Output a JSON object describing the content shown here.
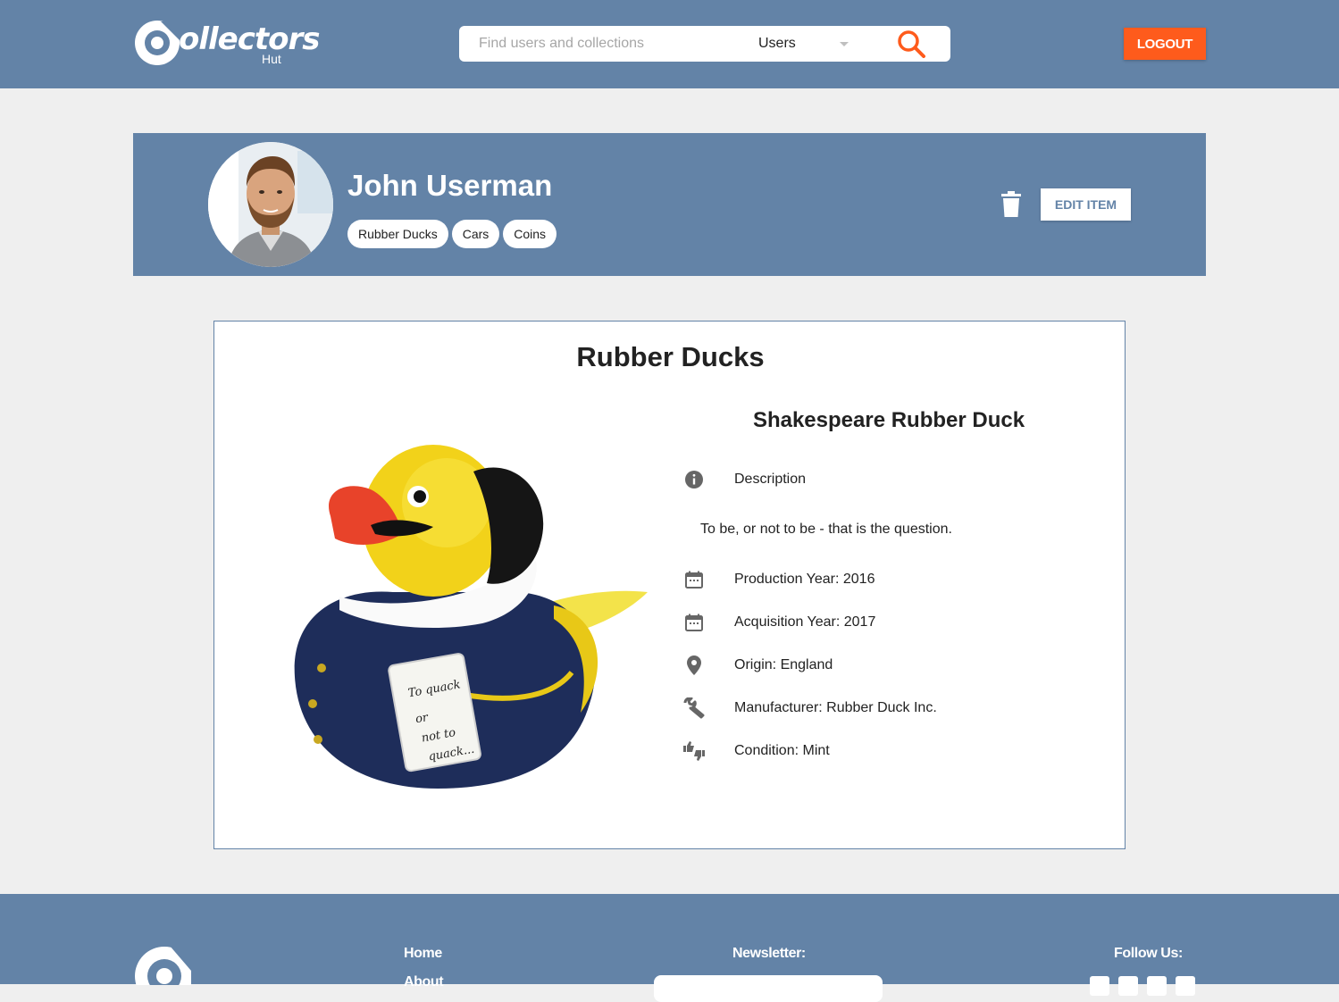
{
  "header": {
    "logo_word": "ollectors",
    "logo_sub": "Hut",
    "search_placeholder": "Find users and collections",
    "search_scope": "Users",
    "logout_label": "LOGOUT"
  },
  "profile": {
    "name": "John Userman",
    "tags": [
      "Rubber Ducks",
      "Cars",
      "Coins"
    ],
    "edit_label": "EDIT ITEM"
  },
  "item": {
    "collection": "Rubber Ducks",
    "title": "Shakespeare Rubber Duck",
    "description_label": "Description",
    "description": "To be, or not to be - that is the question.",
    "production": "Production Year: 2016",
    "acquisition": "Acquisition Year: 2017",
    "origin": "Origin: England",
    "manufacturer": "Manufacturer: Rubber Duck Inc.",
    "condition": "Condition: Mint",
    "scroll_text": [
      "To quack",
      "or",
      "not to",
      "quack..."
    ]
  },
  "footer": {
    "nav": [
      "Home",
      "About"
    ],
    "newsletter_label": "Newsletter:",
    "follow_label": "Follow Us:"
  },
  "colors": {
    "brand_blue": "#6383a7",
    "accent_orange": "#fe5b1c",
    "page_bg": "#efefef"
  }
}
